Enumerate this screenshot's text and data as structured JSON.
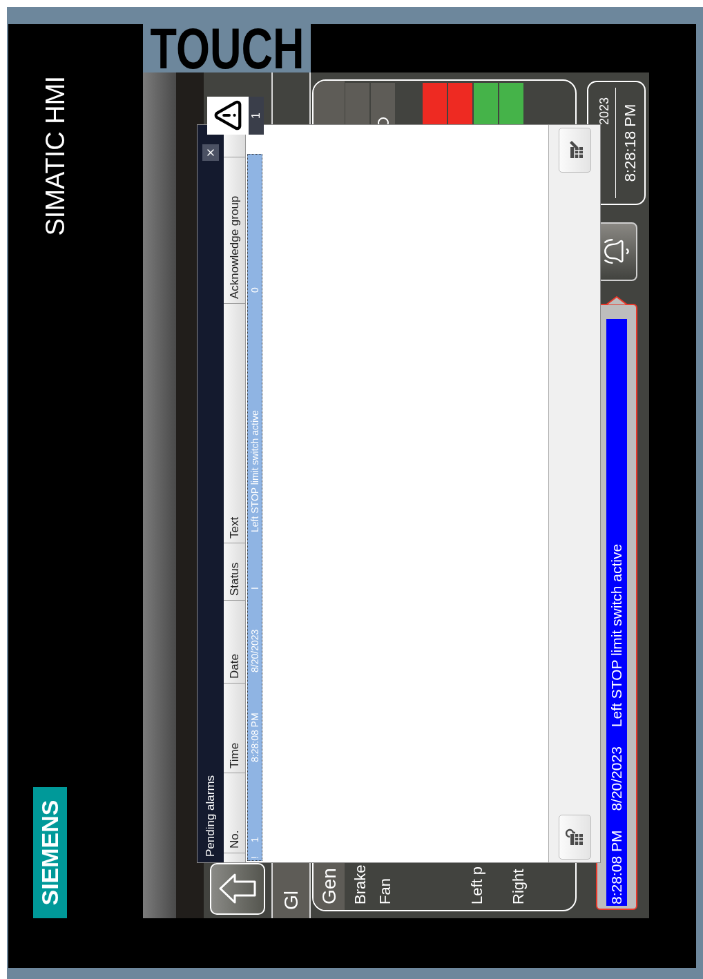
{
  "device": {
    "logo": "SIEMENS",
    "model": "SIMATIC HMI",
    "label": "TOUCH"
  },
  "hmi": {
    "screen_tab": "Gl",
    "panel": {
      "tab": "Gen",
      "rows": [
        "Brake",
        "Fan",
        "Left p",
        "Right"
      ],
      "indicators": [
        {
          "kind": "plain",
          "color": "#5e5c57"
        },
        {
          "kind": "ring",
          "color": "#5e5c57"
        },
        {
          "kind": "plain",
          "color": "#ee2a22"
        },
        {
          "kind": "plain",
          "color": "#ee2a22"
        },
        {
          "kind": "plain",
          "color": "#45b349"
        },
        {
          "kind": "plain",
          "color": "#45b349"
        }
      ]
    },
    "alarm_indicator": {
      "count": "1"
    },
    "alarm_line": {
      "time": "8:28:08 PM",
      "date": "8/20/2023",
      "text": "Left STOP limit switch active"
    },
    "clock": {
      "date": "2023",
      "time": "8:28:18 PM"
    }
  },
  "dialog": {
    "title": "Pending alarms",
    "columns": [
      "No.",
      "Time",
      "Date",
      "Status",
      "Text",
      "Acknowledge group"
    ],
    "alarms": [
      {
        "selected": true,
        "marker": "!",
        "number": "1",
        "time": "8:28:08 PM",
        "date": "8/20/2023",
        "status": "I",
        "text": "Left STOP limit switch active",
        "ack_group": "0"
      }
    ]
  }
}
